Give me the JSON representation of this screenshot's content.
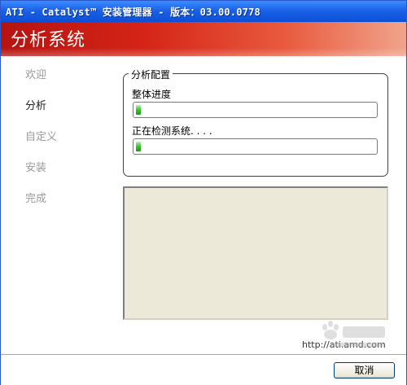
{
  "window": {
    "title": "ATI - Catalyst™ 安装管理器 - 版本：03.00.0778"
  },
  "banner": {
    "title": "分析系统"
  },
  "nav": {
    "items": [
      {
        "label": "欢迎",
        "state": "inactive"
      },
      {
        "label": "分析",
        "state": "active"
      },
      {
        "label": "自定义",
        "state": "inactive"
      },
      {
        "label": "安装",
        "state": "inactive"
      },
      {
        "label": "完成",
        "state": "inactive"
      }
    ]
  },
  "analysis": {
    "group_label": "分析配置",
    "overall": {
      "label": "整体进度",
      "progress_percent": 2
    },
    "detect": {
      "label": "正在检测系统. . . .",
      "progress_percent": 2
    }
  },
  "footer": {
    "url": "http://ati.amd.com",
    "cancel_label": "取消"
  },
  "colors": {
    "titlebar": "#1b62e8",
    "banner": "#d52417",
    "progress_fill": "#38c22f"
  }
}
